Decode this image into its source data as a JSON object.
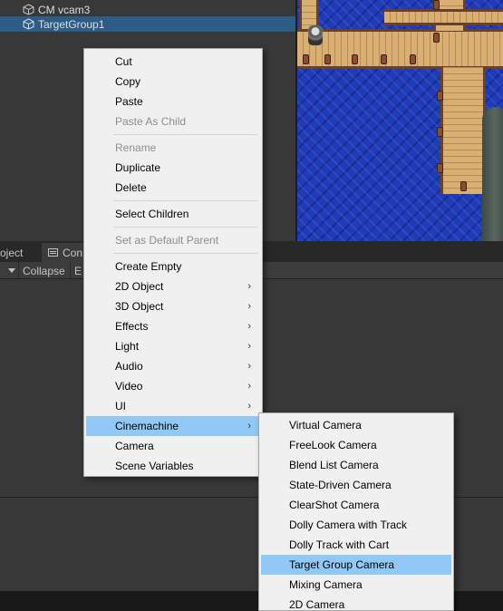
{
  "hierarchy": {
    "items": [
      {
        "label": "CM vcam3",
        "selected": false
      },
      {
        "label": "TargetGroup1",
        "selected": true
      }
    ]
  },
  "dock": {
    "tabs": [
      "oject",
      "Con"
    ],
    "toolbar": {
      "collapse": "Collapse",
      "next": "E"
    }
  },
  "context_menu": {
    "items": [
      {
        "label": "Cut",
        "disabled": false
      },
      {
        "label": "Copy",
        "disabled": false
      },
      {
        "label": "Paste",
        "disabled": false
      },
      {
        "label": "Paste As Child",
        "disabled": true
      },
      {
        "label": "Rename",
        "disabled": true
      },
      {
        "label": "Duplicate",
        "disabled": false
      },
      {
        "label": "Delete",
        "disabled": false
      },
      {
        "label": "Select Children",
        "disabled": false
      },
      {
        "label": "Set as Default Parent",
        "disabled": true
      },
      {
        "label": "Create Empty",
        "disabled": false
      },
      {
        "label": "2D Object",
        "submenu": true
      },
      {
        "label": "3D Object",
        "submenu": true
      },
      {
        "label": "Effects",
        "submenu": true
      },
      {
        "label": "Light",
        "submenu": true
      },
      {
        "label": "Audio",
        "submenu": true
      },
      {
        "label": "Video",
        "submenu": true
      },
      {
        "label": "UI",
        "submenu": true
      },
      {
        "label": "Cinemachine",
        "submenu": true,
        "highlighted": true
      },
      {
        "label": "Camera",
        "disabled": false
      },
      {
        "label": "Scene Variables",
        "disabled": false
      }
    ],
    "submenu_arrow": "›"
  },
  "cinemachine_submenu": {
    "items": [
      {
        "label": "Virtual Camera"
      },
      {
        "label": "FreeLook Camera"
      },
      {
        "label": "Blend List Camera"
      },
      {
        "label": "State-Driven Camera"
      },
      {
        "label": "ClearShot Camera"
      },
      {
        "label": "Dolly Camera with Track"
      },
      {
        "label": "Dolly Track with Cart"
      },
      {
        "label": "Target Group Camera",
        "highlighted": true
      },
      {
        "label": "Mixing Camera"
      },
      {
        "label": "2D Camera"
      }
    ]
  },
  "colors": {
    "menu_bg": "#f0f0f0",
    "menu_highlight": "#90c8f6",
    "selection": "#2c5d87",
    "disabled_text": "#8d8d8d"
  }
}
